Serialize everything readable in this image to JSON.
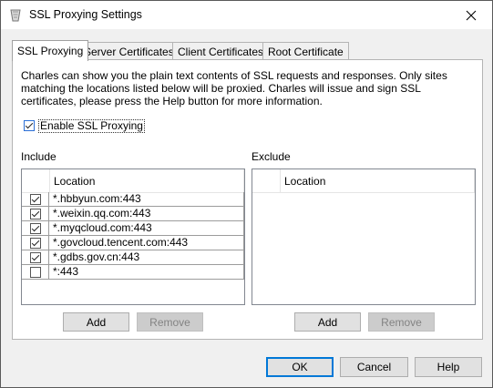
{
  "window": {
    "title": "SSL Proxying Settings"
  },
  "tabs": [
    {
      "label": "SSL Proxying",
      "active": true
    },
    {
      "label": "Server Certificates",
      "active": false
    },
    {
      "label": "Client Certificates",
      "active": false
    },
    {
      "label": "Root Certificate",
      "active": false
    }
  ],
  "description": "Charles can show you the plain text contents of SSL requests and responses. Only sites matching the locations listed below will be proxied. Charles will issue and sign SSL certificates, please press the Help button for more information.",
  "enable": {
    "label": "Enable SSL Proxying",
    "checked": true
  },
  "include": {
    "label": "Include",
    "column": "Location",
    "rows": [
      {
        "location": "*.hbbyun.com:443",
        "checked": true
      },
      {
        "location": "*.weixin.qq.com:443",
        "checked": true
      },
      {
        "location": "*.myqcloud.com:443",
        "checked": true
      },
      {
        "location": "*.govcloud.tencent.com:443",
        "checked": true
      },
      {
        "location": "*.gdbs.gov.cn:443",
        "checked": true
      },
      {
        "location": "*:443",
        "checked": false
      }
    ],
    "add_label": "Add",
    "remove_label": "Remove"
  },
  "exclude": {
    "label": "Exclude",
    "column": "Location",
    "rows": [],
    "add_label": "Add",
    "remove_label": "Remove"
  },
  "footer": {
    "ok_label": "OK",
    "cancel_label": "Cancel",
    "help_label": "Help"
  },
  "colors": {
    "accent": "#0078d7",
    "window_bg": "#f0f0f0",
    "panel_bg": "#ffffff"
  }
}
